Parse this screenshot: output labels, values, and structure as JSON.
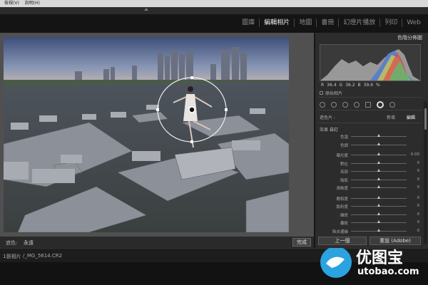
{
  "menu": {
    "items": [
      "檢視(V)",
      "說明(H)"
    ]
  },
  "modules": [
    {
      "label": "圖庫",
      "active": false
    },
    {
      "label": "編輯相片",
      "active": true
    },
    {
      "label": "地圖",
      "active": false
    },
    {
      "label": "書冊",
      "active": false
    },
    {
      "label": "幻燈片播放",
      "active": false
    },
    {
      "label": "列印",
      "active": false
    },
    {
      "label": "Web",
      "active": false
    }
  ],
  "histogram": {
    "title": "色階分佈圖",
    "readout": {
      "r_label": "R",
      "r_value": "36.4",
      "g_label": "G",
      "g_value": "36.2",
      "b_label": "B",
      "b_value": "39.6",
      "unit": "%"
    },
    "original_label": "原始相片"
  },
  "mask": {
    "title": "遮色片 :",
    "new_label": "新增",
    "edit_label": "編輯"
  },
  "effect": {
    "label": "效果 :",
    "value": "自訂"
  },
  "sliders": [
    {
      "label": "色溫",
      "level": 0.5,
      "value": ""
    },
    {
      "label": "色調",
      "level": 0.5,
      "value": ""
    },
    {
      "label": "曝光度",
      "level": 0.5,
      "value": "0.00"
    },
    {
      "label": "對比",
      "level": 0.5,
      "value": "0"
    },
    {
      "label": "亮部",
      "level": 0.5,
      "value": "0"
    },
    {
      "label": "陰影",
      "level": 0.5,
      "value": "0"
    },
    {
      "label": "清晰度",
      "level": 0.5,
      "value": "0"
    },
    {
      "label": "飽和度",
      "level": 0.5,
      "value": "0"
    },
    {
      "label": "銳利度",
      "level": 0.5,
      "value": "0"
    },
    {
      "label": "雜訊",
      "level": 0.5,
      "value": "0"
    },
    {
      "label": "疊紋",
      "level": 0.5,
      "value": "0"
    },
    {
      "label": "除去邊緣",
      "level": 0.5,
      "value": "0"
    }
  ],
  "panel_buttons": {
    "prev": "上一個",
    "reset": "重設 (Adobe)"
  },
  "toolbar": {
    "mask_label": "遮色:",
    "mask_value": "永遠",
    "done": "完成"
  },
  "filmstrip": {
    "source": "1張相片",
    "file": "/_MG_5614.CR2"
  },
  "watermark": {
    "text_cn": "优图宝",
    "text_en": "utobao.com"
  },
  "colors": {
    "accent": "#2aa3e0",
    "background": "#1a1a1a"
  }
}
